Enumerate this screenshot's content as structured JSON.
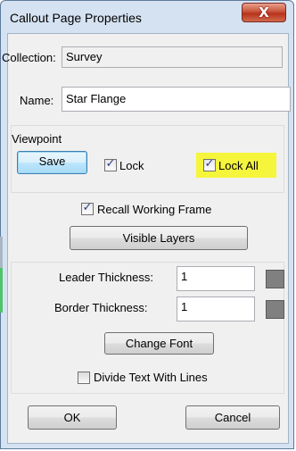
{
  "window": {
    "title": "Callout Page Properties",
    "close_glyph": "X"
  },
  "collection": {
    "label": "Collection:",
    "value": "Survey"
  },
  "name": {
    "label": "Name:",
    "value": "Star Flange"
  },
  "viewpoint": {
    "group_label": "Viewpoint",
    "save_label": "Save",
    "lock": {
      "label": "Lock",
      "checked": true
    },
    "lock_all": {
      "label": "Lock All",
      "checked": true,
      "highlight_color": "#f5f53c"
    }
  },
  "recall_working_frame": {
    "label": "Recall Working Frame",
    "checked": true
  },
  "visible_layers_label": "Visible Layers",
  "leader_thickness": {
    "label": "Leader Thickness:",
    "value": "1",
    "swatch_color": "#808080"
  },
  "border_thickness": {
    "label": "Border Thickness:",
    "value": "1",
    "swatch_color": "#808080"
  },
  "change_font_label": "Change Font",
  "divide_text": {
    "label": "Divide Text With Lines",
    "checked": false
  },
  "ok_label": "OK",
  "cancel_label": "Cancel",
  "check_glyph": "✓",
  "colors": {
    "frame": "#d5e2f2",
    "client": "#f0f0f0",
    "close": "#c8543a",
    "default_button": "#3c7fb1"
  }
}
